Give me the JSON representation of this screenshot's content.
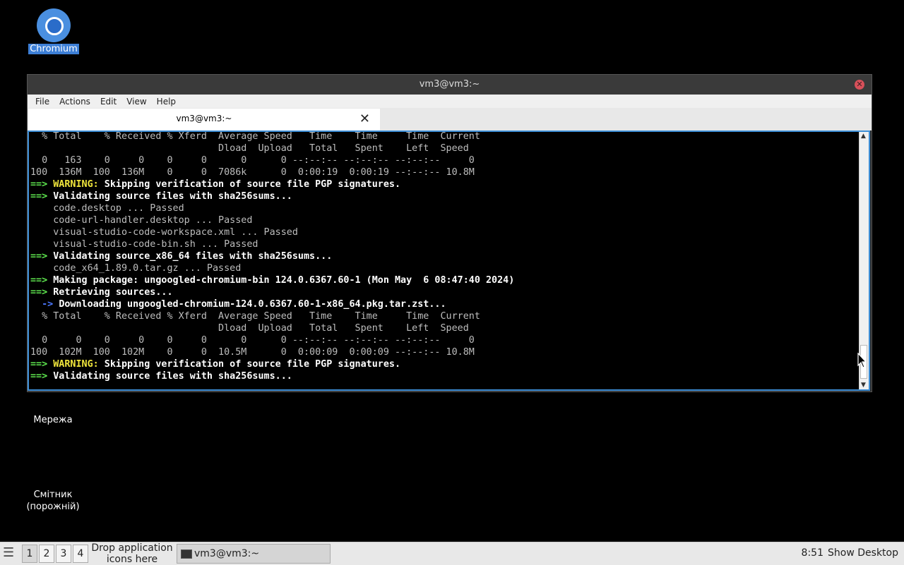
{
  "desktop": {
    "chromium_label": "Chromium",
    "network_label": "Мережа",
    "trash_label_line1": "Смітник",
    "trash_label_line2": "(порожній)"
  },
  "window": {
    "title": "vm3@vm3:~",
    "menu": [
      "File",
      "Actions",
      "Edit",
      "View",
      "Help"
    ],
    "tab_label": "vm3@vm3:~"
  },
  "terminal": {
    "lines": [
      {
        "segments": [
          {
            "text": "  % Total    % Received % Xferd  Average Speed   Time    Time     Time  Current",
            "cls": ""
          }
        ]
      },
      {
        "segments": [
          {
            "text": "                                 Dload  Upload   Total   Spent    Left  Speed",
            "cls": ""
          }
        ]
      },
      {
        "segments": [
          {
            "text": "  0   163    0     0    0     0      0      0 --:--:-- --:--:-- --:--:--     0",
            "cls": ""
          }
        ]
      },
      {
        "segments": [
          {
            "text": "100  136M  100  136M    0     0  7086k      0  0:00:19  0:00:19 --:--:-- 10.8M",
            "cls": ""
          }
        ]
      },
      {
        "segments": [
          {
            "text": "==> ",
            "cls": "g"
          },
          {
            "text": "WARNING:",
            "cls": "y"
          },
          {
            "text": " Skipping verification of source file PGP signatures.",
            "cls": "w"
          }
        ]
      },
      {
        "segments": [
          {
            "text": "==> ",
            "cls": "g"
          },
          {
            "text": "Validating source files with sha256sums...",
            "cls": "w"
          }
        ]
      },
      {
        "segments": [
          {
            "text": "    code.desktop ... Passed",
            "cls": ""
          }
        ]
      },
      {
        "segments": [
          {
            "text": "    code-url-handler.desktop ... Passed",
            "cls": ""
          }
        ]
      },
      {
        "segments": [
          {
            "text": "    visual-studio-code-workspace.xml ... Passed",
            "cls": ""
          }
        ]
      },
      {
        "segments": [
          {
            "text": "    visual-studio-code-bin.sh ... Passed",
            "cls": ""
          }
        ]
      },
      {
        "segments": [
          {
            "text": "==> ",
            "cls": "g"
          },
          {
            "text": "Validating source_x86_64 files with sha256sums...",
            "cls": "w"
          }
        ]
      },
      {
        "segments": [
          {
            "text": "    code_x64_1.89.0.tar.gz ... Passed",
            "cls": ""
          }
        ]
      },
      {
        "segments": [
          {
            "text": "==> ",
            "cls": "g"
          },
          {
            "text": "Making package: ungoogled-chromium-bin 124.0.6367.60-1 (Mon May  6 08:47:40 2024)",
            "cls": "w"
          }
        ]
      },
      {
        "segments": [
          {
            "text": "==> ",
            "cls": "g"
          },
          {
            "text": "Retrieving sources...",
            "cls": "w"
          }
        ]
      },
      {
        "segments": [
          {
            "text": "  -> ",
            "cls": "b"
          },
          {
            "text": "Downloading ungoogled-chromium-124.0.6367.60-1-x86_64.pkg.tar.zst...",
            "cls": "w"
          }
        ]
      },
      {
        "segments": [
          {
            "text": "  % Total    % Received % Xferd  Average Speed   Time    Time     Time  Current",
            "cls": ""
          }
        ]
      },
      {
        "segments": [
          {
            "text": "                                 Dload  Upload   Total   Spent    Left  Speed",
            "cls": ""
          }
        ]
      },
      {
        "segments": [
          {
            "text": "  0     0    0     0    0     0      0      0 --:--:-- --:--:-- --:--:--     0",
            "cls": ""
          }
        ]
      },
      {
        "segments": [
          {
            "text": "100  102M  100  102M    0     0  10.5M      0  0:00:09  0:00:09 --:--:-- 10.8M",
            "cls": ""
          }
        ]
      },
      {
        "segments": [
          {
            "text": "==> ",
            "cls": "g"
          },
          {
            "text": "WARNING:",
            "cls": "y"
          },
          {
            "text": " Skipping verification of source file PGP signatures.",
            "cls": "w"
          }
        ]
      },
      {
        "segments": [
          {
            "text": "==> ",
            "cls": "g"
          },
          {
            "text": "Validating source files with sha256sums...",
            "cls": "w"
          }
        ]
      }
    ]
  },
  "taskbar": {
    "workspaces": [
      "1",
      "2",
      "3",
      "4"
    ],
    "active_workspace": "1",
    "drop_line1": "Drop application",
    "drop_line2": "icons here",
    "task_label": "vm3@vm3:~",
    "clock": "8:51",
    "show_desktop": "Show Desktop"
  },
  "colors": {
    "prompt_arrow": "#5fe84f",
    "warning": "#f0e63c",
    "sub_arrow": "#4c78ff",
    "terminal_border": "#3d8ed6"
  },
  "icons": [
    "chromium-icon",
    "network-icon",
    "trash-icon",
    "close-icon",
    "start-menu-icon",
    "terminal-icon",
    "mouse-pointer-icon"
  ]
}
